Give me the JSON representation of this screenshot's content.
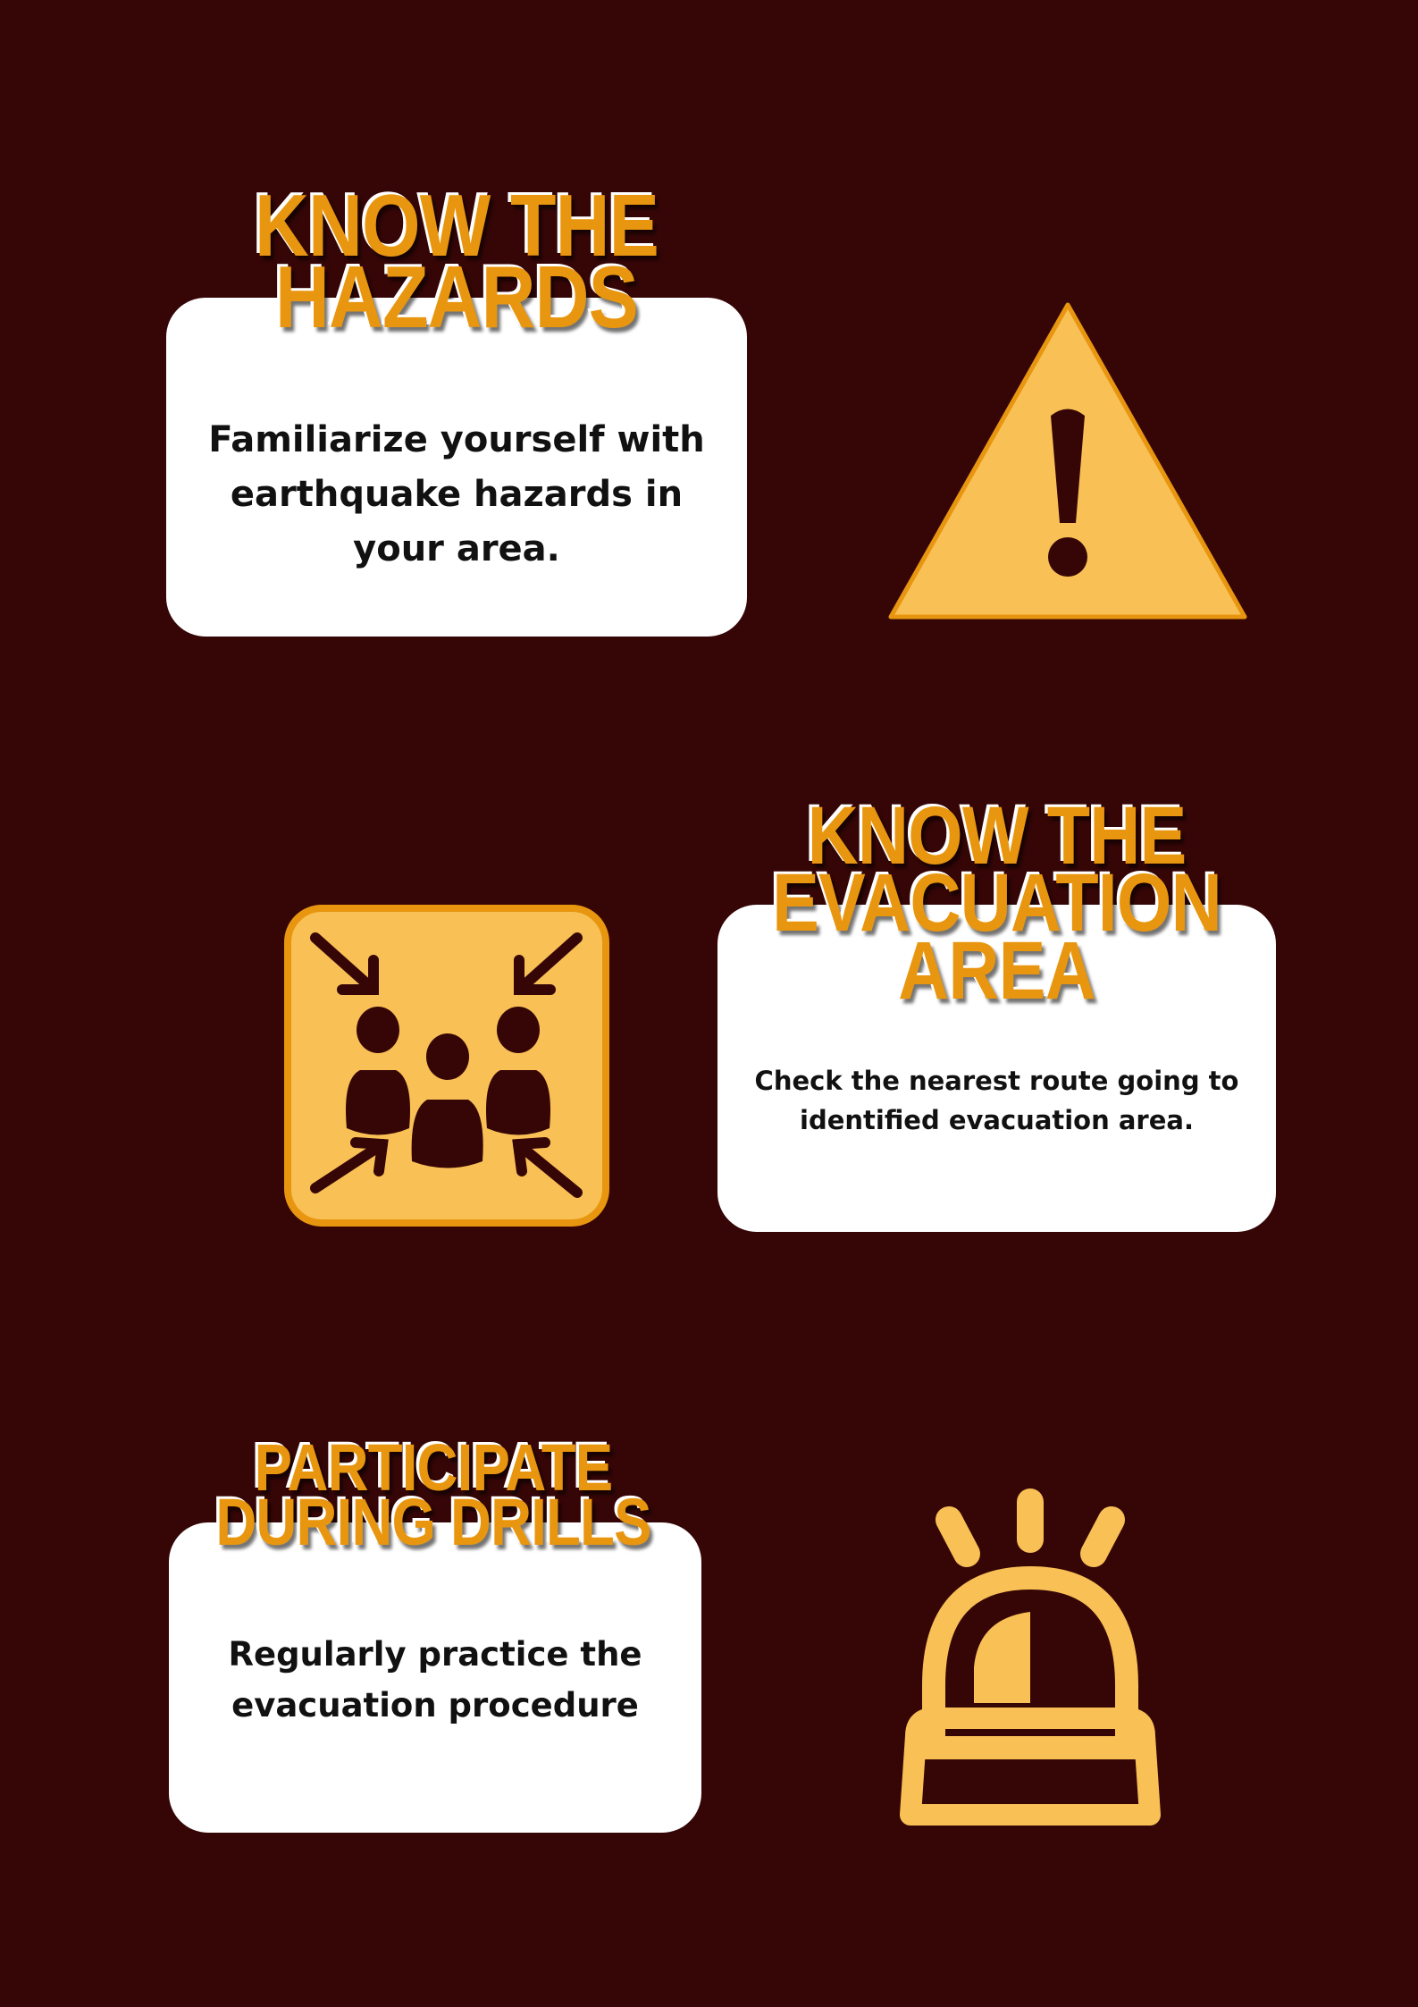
{
  "sections": [
    {
      "title_lines": [
        "KNOW THE",
        "HAZARDS"
      ],
      "body_lines": [
        "Familiarize yourself with",
        "earthquake hazards in",
        "your area."
      ],
      "icon": "warning-triangle-icon"
    },
    {
      "title_lines": [
        "KNOW THE",
        "EVACUATION",
        "AREA"
      ],
      "body_lines": [
        "Check the nearest route going to",
        "identified evacuation area."
      ],
      "icon": "assembly-point-icon"
    },
    {
      "title_lines": [
        "PARTICIPATE",
        "DURING DRILLS"
      ],
      "body_lines": [
        "Regularly practice the",
        "evacuation procedure"
      ],
      "icon": "siren-alarm-icon"
    }
  ],
  "colors": {
    "background": "#360607",
    "accent": "#e8960f",
    "icon_fill": "#f8c055",
    "card": "#ffffff"
  }
}
